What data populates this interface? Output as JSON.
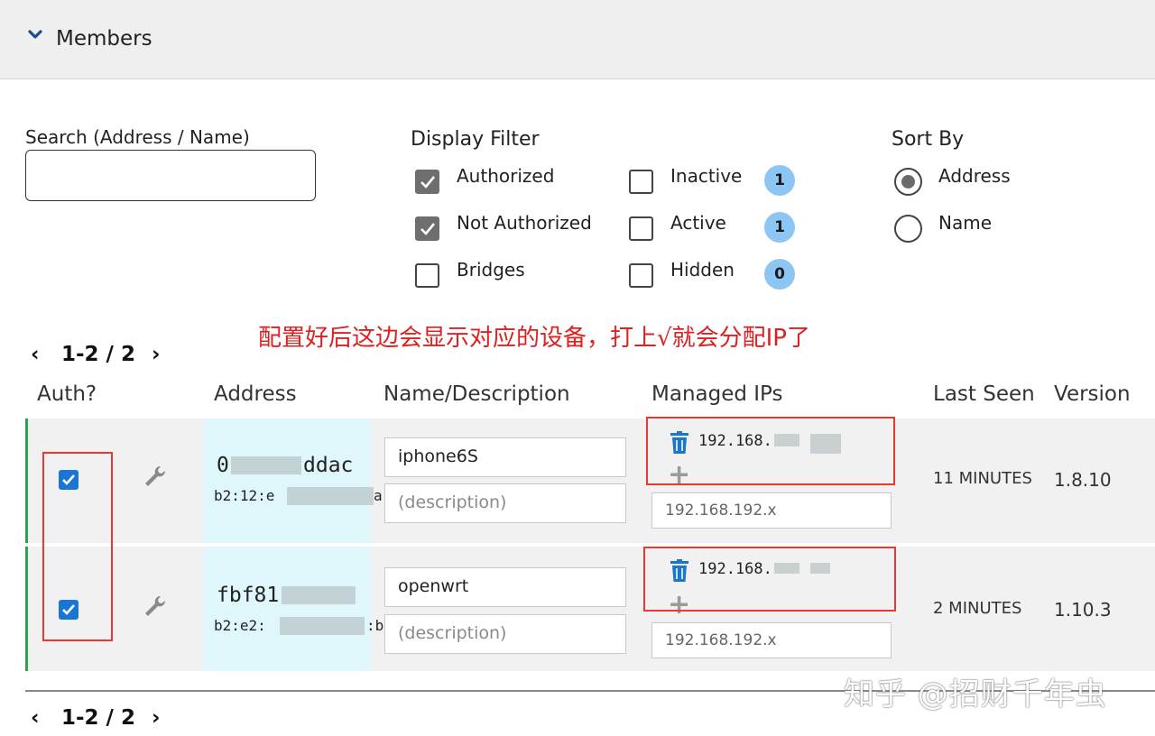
{
  "header": {
    "title": "Members",
    "icon": "chevron-down-icon"
  },
  "search": {
    "label": "Search (Address / Name)",
    "value": ""
  },
  "display_filter": {
    "title": "Display Filter",
    "options": [
      {
        "label": "Authorized",
        "checked": true
      },
      {
        "label": "Not Authorized",
        "checked": true
      },
      {
        "label": "Bridges",
        "checked": false
      },
      {
        "label": "Inactive",
        "checked": false,
        "count": "1"
      },
      {
        "label": "Active",
        "checked": false,
        "count": "1"
      },
      {
        "label": "Hidden",
        "checked": false,
        "count": "0"
      }
    ]
  },
  "sort_by": {
    "title": "Sort By",
    "options": [
      {
        "label": "Address",
        "selected": true
      },
      {
        "label": "Name",
        "selected": false
      }
    ]
  },
  "annotation": "配置好后这边会显示对应的设备，打上√就会分配IP了",
  "pagination": {
    "label": "1-2 / 2",
    "prev": "‹",
    "next": "›"
  },
  "columns": {
    "auth": "Auth?",
    "address": "Address",
    "name": "Name/Description",
    "ips": "Managed IPs",
    "last_seen": "Last Seen",
    "version": "Version"
  },
  "members": [
    {
      "authorized": true,
      "address_start": "0",
      "address_end": "ddac",
      "mac_start": "b2:12:e",
      "mac_end": "a",
      "name": "iphone6S",
      "description_placeholder": "(description)",
      "ip_prefix": "192.168.",
      "ip_placeholder": "192.168.192.x",
      "last_seen": "11 MINUTES",
      "version": "1.8.10"
    },
    {
      "authorized": true,
      "address_start": "fbf81",
      "address_end": "",
      "mac_start": "b2:e2:",
      "mac_end": ":b",
      "name": "openwrt",
      "description_placeholder": "(description)",
      "ip_prefix": "192.168.",
      "ip_placeholder": "192.168.192.x",
      "last_seen": "2 MINUTES",
      "version": "1.10.3"
    }
  ],
  "watermark": "知乎 @招财千年虫",
  "colors": {
    "checkbox_blue": "#1976d2",
    "badge": "#8cc6f5",
    "annotation_red": "#e02020",
    "row_accent": "#2aa34a"
  }
}
